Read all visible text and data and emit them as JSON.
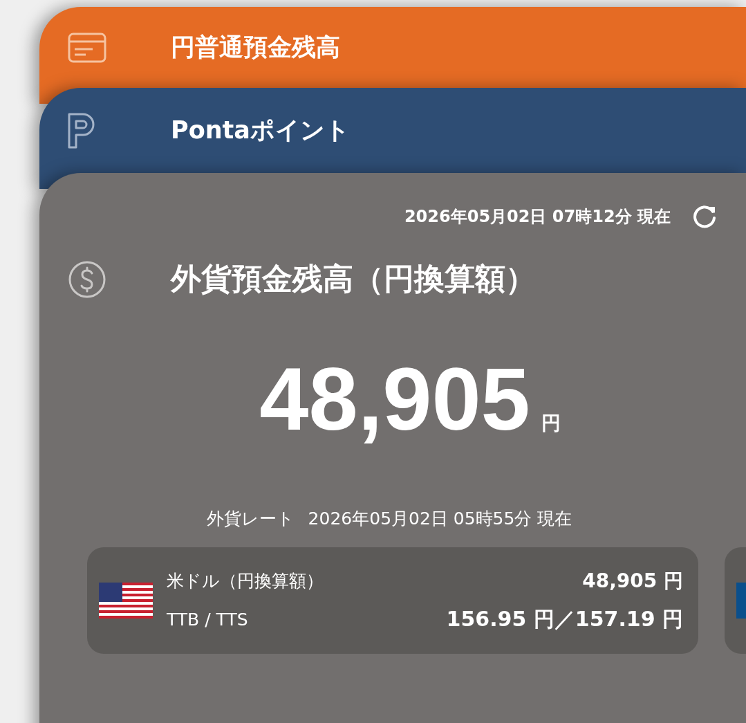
{
  "accounts": [
    {
      "kind": "yen",
      "title": "円普通預金残高",
      "color": "#e56b24"
    },
    {
      "kind": "points",
      "title": "Pontaポイント",
      "color": "#2e4d74"
    }
  ],
  "foreign_deposit": {
    "updated": "2026年05月02日 07時12分 現在",
    "title": "外貨預金残高（円換算額）",
    "amount": "48,905",
    "unit": "円",
    "rate_label": "外貨レート",
    "rate_time": "2026年05月02日 05時55分 現在",
    "currencies": [
      {
        "name": "米ドル（円換算額）",
        "amount": "48,905 円",
        "rate_label": "TTB / TTS",
        "rates": "156.95 円／157.19 円"
      }
    ]
  }
}
